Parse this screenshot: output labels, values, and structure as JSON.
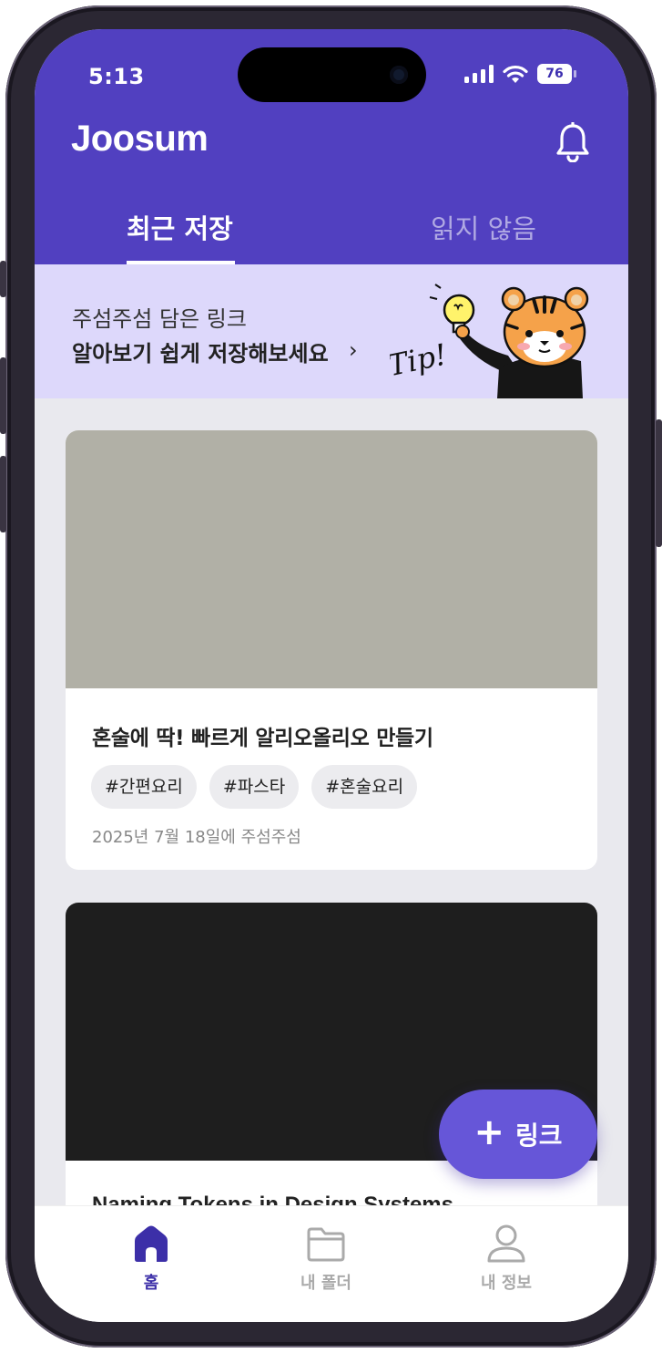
{
  "status_bar": {
    "time": "5:13",
    "battery": "76"
  },
  "header": {
    "title": "Joosum",
    "tabs": [
      {
        "label": "최근 저장",
        "active": true
      },
      {
        "label": "읽지 않음",
        "active": false
      }
    ]
  },
  "banner": {
    "line1": "주섬주섬 담은 링크",
    "line2": "알아보기 쉽게 저장해보세요",
    "chevron": "›",
    "art_text": "Tip!"
  },
  "cards": [
    {
      "image": "pasta-with-shrimp-photo",
      "title": "혼술에 딱! 빠르게 알리오올리오 만들기",
      "tags": [
        "#간편요리",
        "#파스타",
        "#혼술요리"
      ],
      "date": "2025년 7월 18일에 주섬주섬"
    },
    {
      "image": "pixel-art-text-thumbnail",
      "title": "Naming Tokens in Design Systems"
    }
  ],
  "fab": {
    "plus": "+",
    "label": "링크"
  },
  "tab_bar": [
    {
      "label": "홈",
      "icon": "home-icon",
      "active": true
    },
    {
      "label": "내 폴더",
      "icon": "folder-icon",
      "active": false
    },
    {
      "label": "내 정보",
      "icon": "person-icon",
      "active": false
    }
  ],
  "colors": {
    "brand": "#5140c0",
    "banner_bg": "#ddd8fb",
    "fab": "#6656d8",
    "active_tab": "#3c2fa8"
  }
}
